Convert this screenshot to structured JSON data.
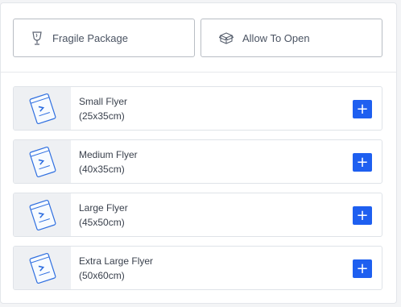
{
  "options": {
    "fragile": {
      "label": "Fragile Package",
      "icon": "wine-glass-icon"
    },
    "allow_open": {
      "label": "Allow To Open",
      "icon": "open-box-icon"
    }
  },
  "items": [
    {
      "name": "Small Flyer",
      "size": "(25x35cm)",
      "add_label": "+"
    },
    {
      "name": "Medium Flyer",
      "size": "(40x35cm)",
      "add_label": "+"
    },
    {
      "name": "Large Flyer",
      "size": "(45x50cm)",
      "add_label": "+"
    },
    {
      "name": "Extra Large Flyer",
      "size": "(50x60cm)",
      "add_label": "+"
    }
  ],
  "colors": {
    "accent": "#1e5ff0",
    "border": "#b8bdc4"
  }
}
